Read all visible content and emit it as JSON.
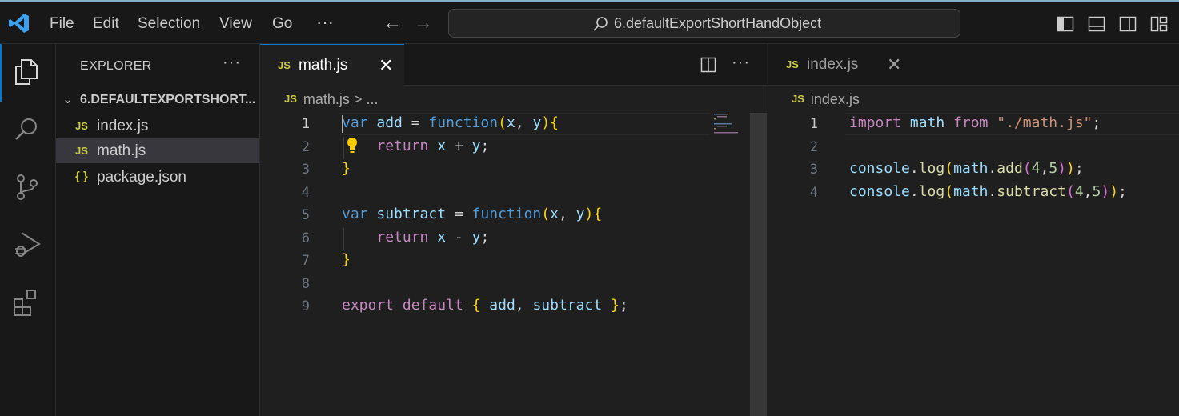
{
  "titlebar": {
    "menu": [
      "File",
      "Edit",
      "Selection",
      "View",
      "Go"
    ],
    "more": "···",
    "back_icon": "←",
    "forward_icon": "→",
    "search_text": "6.defaultExportShortHandObject"
  },
  "activitybar": {
    "items": [
      "explorer-icon",
      "search-icon",
      "source-control-icon",
      "run-debug-icon",
      "extensions-icon"
    ]
  },
  "sidebar": {
    "title": "EXPLORER",
    "more": "···",
    "folder_chevron": "⌄",
    "folder": "6.DEFAULTEXPORTSHORT...",
    "files": [
      {
        "badge": "JS",
        "name": "index.js"
      },
      {
        "badge": "JS",
        "name": "math.js"
      },
      {
        "badge": "{ }",
        "name": "package.json"
      }
    ]
  },
  "editor_left": {
    "tab": {
      "badge": "JS",
      "label": "math.js",
      "close": "✕"
    },
    "more": "···",
    "breadcrumb": {
      "badge": "JS",
      "file": "math.js",
      "sep": " > ",
      "rest": "..."
    },
    "line_numbers": [
      "1",
      "2",
      "3",
      "4",
      "5",
      "6",
      "7",
      "8",
      "9"
    ],
    "lines": [
      [
        "var",
        " ",
        "add",
        " = ",
        "function",
        "(",
        "x",
        ", ",
        "y",
        ")",
        "{"
      ],
      [
        "    ",
        "return",
        " ",
        "x",
        " + ",
        "y",
        ";"
      ],
      [
        "}"
      ],
      [
        ""
      ],
      [
        "var",
        " ",
        "subtract",
        " = ",
        "function",
        "(",
        "x",
        ", ",
        "y",
        ")",
        "{"
      ],
      [
        "    ",
        "return",
        " ",
        "x",
        " - ",
        "y",
        ";"
      ],
      [
        "}"
      ],
      [
        ""
      ],
      [
        "export",
        " ",
        "default",
        " ",
        "{",
        " ",
        "add",
        ", ",
        "subtract",
        " ",
        "}",
        ";"
      ]
    ]
  },
  "editor_right": {
    "tab": {
      "badge": "JS",
      "label": "index.js",
      "close": "✕"
    },
    "breadcrumb": {
      "badge": "JS",
      "file": "index.js"
    },
    "line_numbers": [
      "1",
      "2",
      "3",
      "4"
    ],
    "lines": [
      [
        "import",
        " ",
        "math",
        " ",
        "from",
        " ",
        "\"./math.js\"",
        ";"
      ],
      [
        ""
      ],
      [
        "console",
        ".",
        "log",
        "(",
        "math",
        ".",
        "add",
        "(",
        "4",
        ",",
        "5",
        ")",
        ")",
        ";"
      ],
      [
        "console",
        ".",
        "log",
        "(",
        "math",
        ".",
        "subtract",
        "(",
        "4",
        ",",
        "5",
        ")",
        ")",
        ";"
      ]
    ]
  }
}
